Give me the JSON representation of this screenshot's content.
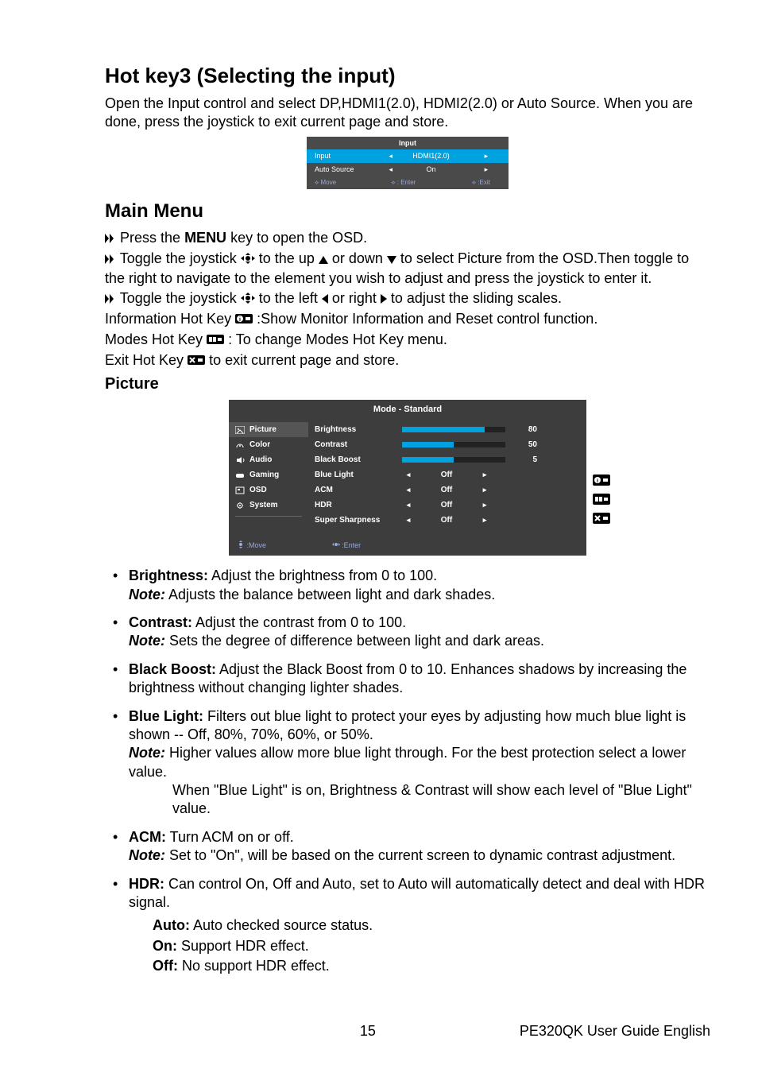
{
  "hotkey3": {
    "title": "Hot key3 (Selecting the input)",
    "desc": "Open the Input control and select DP,HDMI1(2.0), HDMI2(2.0) or Auto Source. When you are done, press the joystick to exit current page and store."
  },
  "input_panel": {
    "title": "Input",
    "rows": [
      {
        "label": "Input",
        "value": "HDMI1(2.0)",
        "highlight": true
      },
      {
        "label": "Auto Source",
        "value": "On",
        "highlight": false
      }
    ],
    "footer": {
      "move": "Move",
      "enter": ": Enter",
      "exit": ":Exit"
    }
  },
  "main_menu": {
    "title": "Main Menu",
    "line1_a": "Press the ",
    "line1_b": "MENU",
    "line1_c": " key to open the OSD.",
    "line2_a": "Toggle the joystick ",
    "line2_b": " to the up ",
    "line2_c": " or down ",
    "line2_d": " to select Picture from the OSD.Then toggle to the right to navigate to the element you wish to adjust and press the joystick to enter it.",
    "line3_a": "Toggle the joystick ",
    "line3_b": " to the left ",
    "line3_c": " or right ",
    "line3_d": " to adjust the sliding scales.",
    "line4_a": "Information Hot Key ",
    "line4_b": " :Show Monitor Information and Reset control function.",
    "line5_a": "Modes Hot Key ",
    "line5_b": " : To change Modes Hot Key menu.",
    "line6_a": "Exit Hot Key ",
    "line6_b": " to exit current page and store."
  },
  "picture_section": {
    "title": "Picture"
  },
  "picture_panel": {
    "mode": "Mode - Standard",
    "side_items": [
      "Picture",
      "Color",
      "Audio",
      "Gaming",
      "OSD",
      "System"
    ],
    "sliders": [
      {
        "label": "Brightness",
        "value": 80,
        "max": 100
      },
      {
        "label": "Contrast",
        "value": 50,
        "max": 100
      },
      {
        "label": "Black Boost",
        "value": 5,
        "max": 10
      }
    ],
    "toggles": [
      {
        "label": "Blue Light",
        "state": "Off"
      },
      {
        "label": "ACM",
        "state": "Off"
      },
      {
        "label": "HDR",
        "state": "Off"
      },
      {
        "label": "Super Sharpness",
        "state": "Off"
      }
    ],
    "footer": {
      "move": ":Move",
      "enter": ":Enter"
    }
  },
  "bullets": {
    "brightness_t": "Brightness:",
    "brightness_d": " Adjust the brightness from 0 to 100.",
    "brightness_n": "Note:",
    "brightness_nd": " Adjusts the balance between light and dark shades.",
    "contrast_t": "Contrast:",
    "contrast_d": " Adjust the contrast from 0 to 100.",
    "contrast_n": "Note:",
    "contrast_nd": " Sets the degree of difference between light and dark areas.",
    "bb_t": "Black Boost:",
    "bb_d": " Adjust the Black Boost from 0 to 10. Enhances shadows by increasing the brightness without changing lighter shades.",
    "bl_t": "Blue Light:",
    "bl_d": " Filters out blue light to protect your eyes by adjusting how much blue light is shown -- Off, 80%, 70%, 60%, or 50%.",
    "bl_n": "Note:",
    "bl_nd": " Higher values allow more blue light through. For the best protection select a lower value.",
    "bl_nd2": "When \"Blue Light\" is on, Brightness & Contrast will show each level of \"Blue Light\" value.",
    "acm_t": "ACM:",
    "acm_d": " Turn ACM on or off.",
    "acm_n": "Note:",
    "acm_nd": " Set to \"On\", will be based on the current screen to dynamic contrast adjustment.",
    "hdr_t": "HDR:",
    "hdr_d": " Can control On, Off and Auto, set to Auto will automatically detect and deal with HDR signal.",
    "hdr_auto_t": "Auto:",
    "hdr_auto_d": " Auto checked source status.",
    "hdr_on_t": "On:",
    "hdr_on_d": " Support HDR effect.",
    "hdr_off_t": "Off:",
    "hdr_off_d": " No support HDR effect."
  },
  "footer": {
    "page": "15",
    "guide": "PE320QK  User Guide English"
  }
}
